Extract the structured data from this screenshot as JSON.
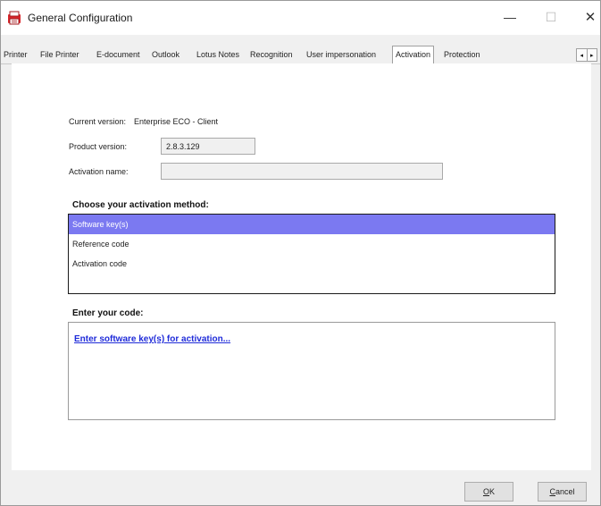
{
  "window": {
    "title": "General Configuration",
    "minimize_glyph": "—",
    "maximize_glyph": "☐",
    "close_glyph": "✕",
    "icon": "app-printer-icon",
    "icon_color": "#d9252a"
  },
  "tabs": [
    {
      "label": "Printer"
    },
    {
      "label": "File Printer"
    },
    {
      "label": "E-document"
    },
    {
      "label": "Outlook"
    },
    {
      "label": "Lotus Notes"
    },
    {
      "label": "Recognition"
    },
    {
      "label": "User impersonation"
    },
    {
      "label": "Activation",
      "active": true
    },
    {
      "label": "Protection"
    }
  ],
  "tab_scroll": {
    "left": "◂",
    "right": "▸"
  },
  "activation": {
    "current_version_label": "Current version:",
    "current_version_value": "Enterprise ECO - Client",
    "product_version_label": "Product version:",
    "product_version_value": "2.8.3.129",
    "activation_name_label": "Activation name:",
    "activation_name_value": ""
  },
  "method": {
    "title": "Choose your activation method:",
    "options": [
      "Software key(s)",
      "Reference code",
      "Activation code"
    ],
    "selected_index": 0,
    "selection_color": "#7b79f1"
  },
  "code": {
    "title": "Enter your code:",
    "link": "Enter software key(s) for activation...",
    "link_color": "#1f2bd9"
  },
  "buttons": {
    "ok_mnemonic": "O",
    "ok_rest": "K",
    "cancel_mnemonic": "C",
    "cancel_rest": "ancel"
  }
}
